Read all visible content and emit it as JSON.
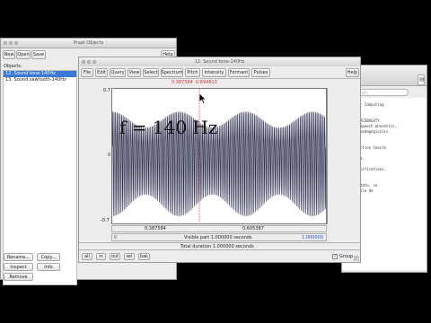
{
  "objects_window": {
    "title": "Praat Objects",
    "menu": [
      "New",
      "Open",
      "Save"
    ],
    "help": "Help",
    "list_label": "Objects:",
    "items": [
      "12. Sound tone-140Hz",
      "13. Sound sawtooth-140Hz"
    ],
    "buttons": [
      "Rename...",
      "Copy...",
      "Inspect",
      "Info",
      "Remove"
    ]
  },
  "info_window": {
    "search_placeholder": "Search",
    "text_lines": [
      "- Computing",
      "",
      "",
      "RCEBAGATY.",
      "Speech phonetics,",
      "pedagogicalis.",
      "",
      "",
      "ction toesle",
      "",
      "a.",
      "",
      "lifications.",
      "",
      "",
      "dato, se",
      "ple de"
    ]
  },
  "sound_window": {
    "title": "12. Sound tone-140Hz",
    "menu": [
      "File",
      "Edit",
      "Query",
      "View",
      "Select",
      "Spectrum",
      "Pitch",
      "Intensity",
      "Formant",
      "Pulses"
    ],
    "help": "Help",
    "cursor_left": "0.387584",
    "cursor_right": "0.894813",
    "y_max": "0.7",
    "y_zero": "0",
    "y_min": "-0.7",
    "annotation": "f = 140 Hz",
    "bottom_left_time": "0.387584",
    "bottom_right_time": "0.605387",
    "visible_start": "0",
    "visible_label": "Visible part 1.000000 seconds",
    "visible_end": "1.000000",
    "total_label": "Total duration 1.000000 seconds",
    "zoom_buttons": [
      "all",
      "in",
      "out",
      "sel",
      "bak"
    ],
    "group_label": "Group",
    "group_checked": true,
    "waveform_color": "#2e2e50",
    "cursor_color": "#e03030"
  }
}
